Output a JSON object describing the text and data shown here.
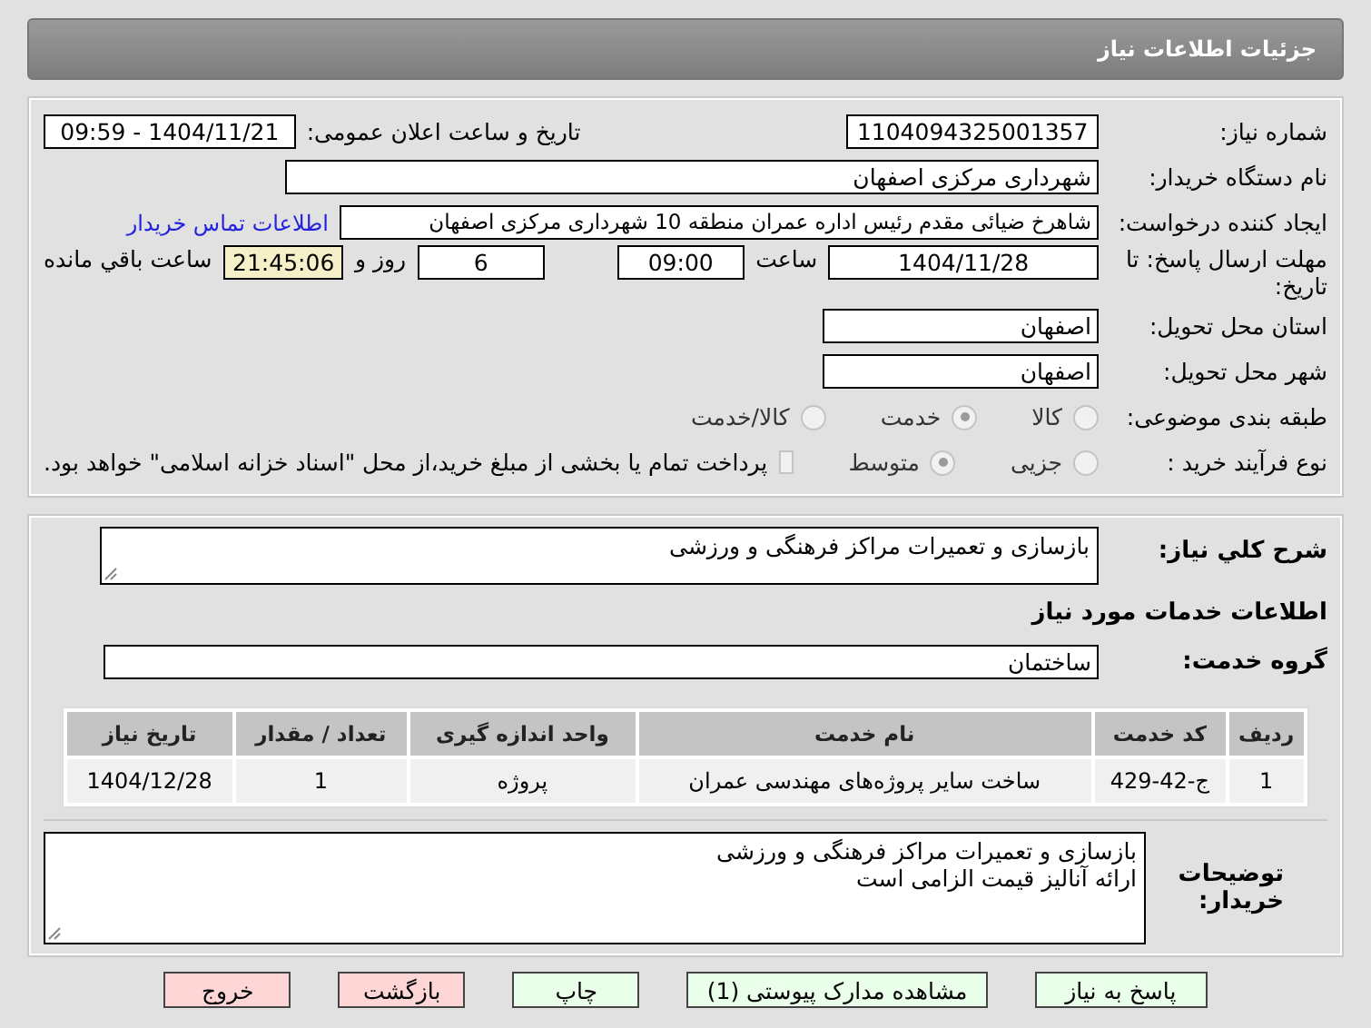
{
  "header": {
    "title": "جزئیات اطلاعات نیاز"
  },
  "details": {
    "need_number": {
      "label": "شماره نیاز:",
      "value": "1104094325001357"
    },
    "announce": {
      "label": "تاریخ و ساعت اعلان عمومی:",
      "value": "1404/11/21 - 09:59"
    },
    "buyer": {
      "label": "نام دستگاه خریدار:",
      "value": "شهرداری مرکزی اصفهان"
    },
    "creator": {
      "label": "ایجاد کننده درخواست:",
      "value": "شاهرخ ضیائی مقدم رئیس اداره عمران منطقه 10 شهرداری مرکزی اصفهان",
      "link": "اطلاعات تماس خریدار"
    },
    "deadline": {
      "label": "مهلت ارسال پاسخ: تا تاریخ:",
      "date": "1404/11/28",
      "time_label": "ساعت",
      "time": "09:00",
      "days": "6",
      "days_label": "روز و",
      "remaining": "21:45:06",
      "remaining_label": "ساعت باقي مانده"
    },
    "province": {
      "label": "استان محل تحویل:",
      "value": "اصفهان"
    },
    "city": {
      "label": "شهر محل تحویل:",
      "value": "اصفهان"
    },
    "category": {
      "label": "طبقه بندی موضوعی:",
      "options": [
        {
          "label": "کالا",
          "selected": false
        },
        {
          "label": "خدمت",
          "selected": true
        },
        {
          "label": "کالا/خدمت",
          "selected": false
        }
      ]
    },
    "process": {
      "label": "نوع فرآیند خرید :",
      "options": [
        {
          "label": "جزیی",
          "selected": false
        },
        {
          "label": "متوسط",
          "selected": true
        }
      ],
      "payment": {
        "checked": false,
        "text": "پرداخت تمام یا بخشی از مبلغ خرید،از محل \"اسناد خزانه اسلامی\" خواهد بود."
      }
    }
  },
  "services": {
    "summary": {
      "label": "شرح کلي نياز:",
      "value": "بازسازی و تعمیرات مراکز فرهنگی و ورزشی"
    },
    "heading": "اطلاعات خدمات مورد نیاز",
    "group": {
      "label": "گروه خدمت:",
      "value": "ساختمان"
    },
    "table": {
      "columns": [
        "ردیف",
        "کد خدمت",
        "نام خدمت",
        "واحد اندازه گیری",
        "تعداد / مقدار",
        "تاریخ نیاز"
      ],
      "rows": [
        [
          "1",
          "ج-42-429",
          "ساخت سایر پروژه‌های مهندسی عمران",
          "پروژه",
          "1",
          "1404/12/28"
        ]
      ]
    },
    "notes": {
      "label": "توضیحات خریدار:",
      "lines": [
        "بازسازی و تعمیرات مراکز فرهنگی و ورزشی",
        "ارائه آنالیز قیمت الزامی است"
      ]
    }
  },
  "buttons": [
    {
      "label": "پاسخ به نیاز",
      "kind": "normal"
    },
    {
      "label": "مشاهده مدارک پیوستی (1)",
      "kind": "normal"
    },
    {
      "label": "چاپ",
      "kind": "normal"
    },
    {
      "label": "بازگشت",
      "kind": "exit"
    },
    {
      "label": "خروج",
      "kind": "exit"
    }
  ]
}
